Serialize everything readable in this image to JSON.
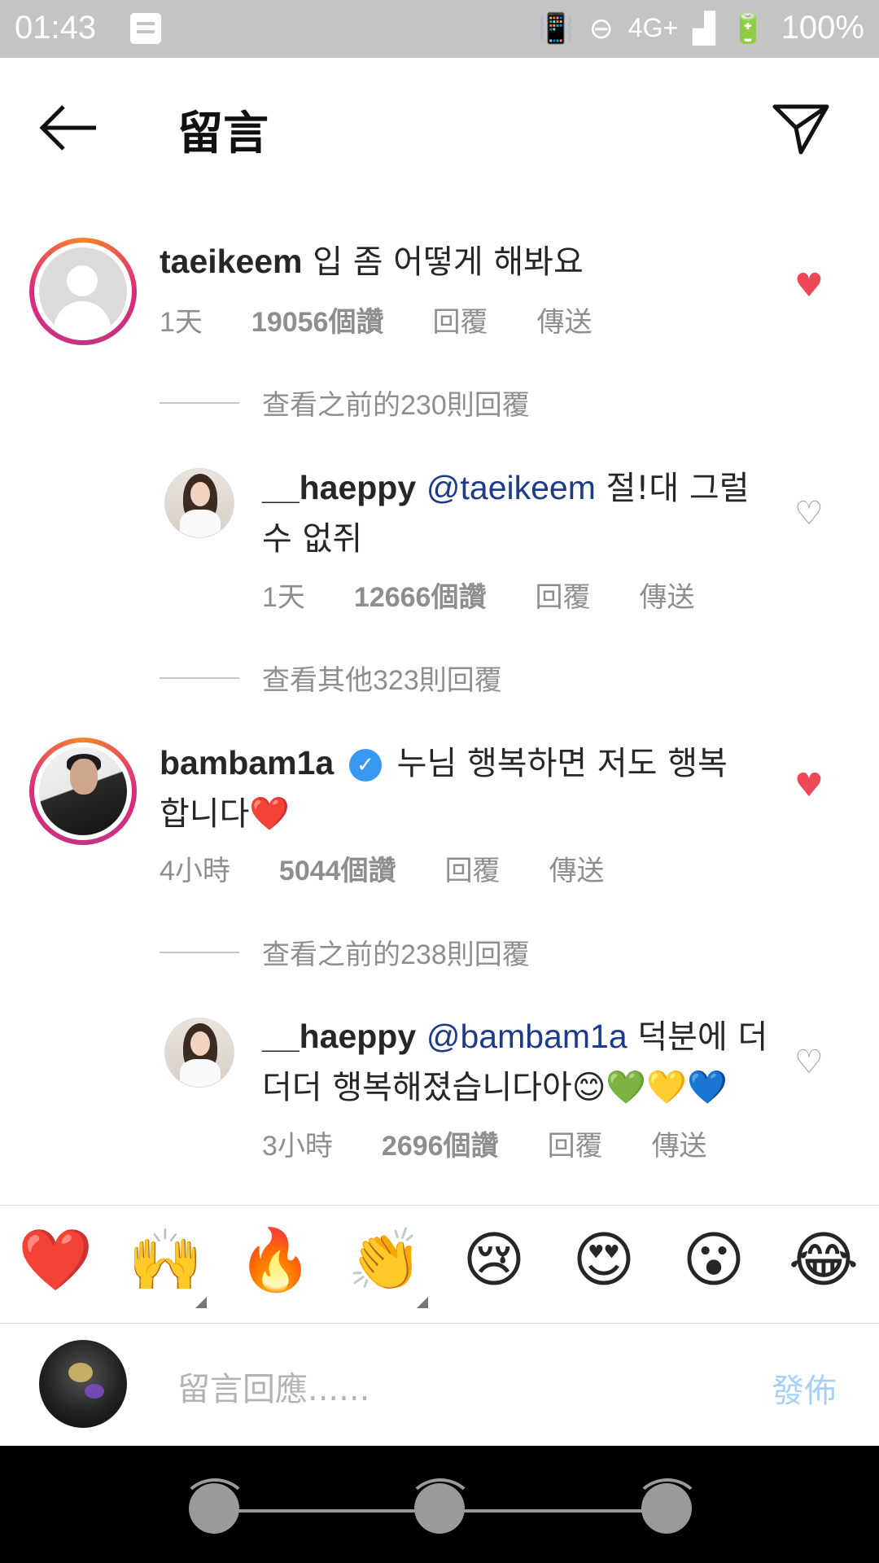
{
  "status_bar": {
    "time": "01:43",
    "network": "4G+",
    "battery": "100%"
  },
  "header": {
    "title": "留言"
  },
  "comments": [
    {
      "username": "taeikeem",
      "text": "입 좀 어떻게 해봐요",
      "time": "1天",
      "likes": "19056個讚",
      "reply": "回覆",
      "send": "傳送",
      "liked": true,
      "view_replies": "查看之前的230則回覆",
      "reply_item": {
        "username": "__haeppy",
        "mention": "@taeikeem",
        "text_line1": "절!대 그럴",
        "text_line2": "수 없쥐",
        "time": "1天",
        "likes": "12666個讚",
        "reply": "回覆",
        "send": "傳送"
      },
      "view_more": "查看其他323則回覆"
    },
    {
      "username": "bambam1a",
      "verified": true,
      "text_line1": "누님 행복하면 저도 행복",
      "text_line2": "합니다❤️",
      "time": "4小時",
      "likes": "5044個讚",
      "reply": "回覆",
      "send": "傳送",
      "liked": true,
      "view_replies": "查看之前的238則回覆",
      "reply_item": {
        "username": "__haeppy",
        "mention": "@bambam1a",
        "text_line1": "덕분에 더",
        "text_line2": "더더 행복해졌습니다아😊💚💛💙",
        "time": "3小時",
        "likes": "2696個讚",
        "reply": "回覆",
        "send": "傳送"
      }
    }
  ],
  "emoji_bar": [
    "❤️",
    "🙌",
    "🔥",
    "👏",
    "😢",
    "😍",
    "😮",
    "😂"
  ],
  "input": {
    "placeholder": "留言回應......",
    "post_label": "發佈"
  },
  "colors": {
    "like_red": "#ed4956",
    "mention_blue": "#1e3a8a",
    "verified_blue": "#3897f0",
    "post_disabled_blue": "#a6d1f6"
  }
}
